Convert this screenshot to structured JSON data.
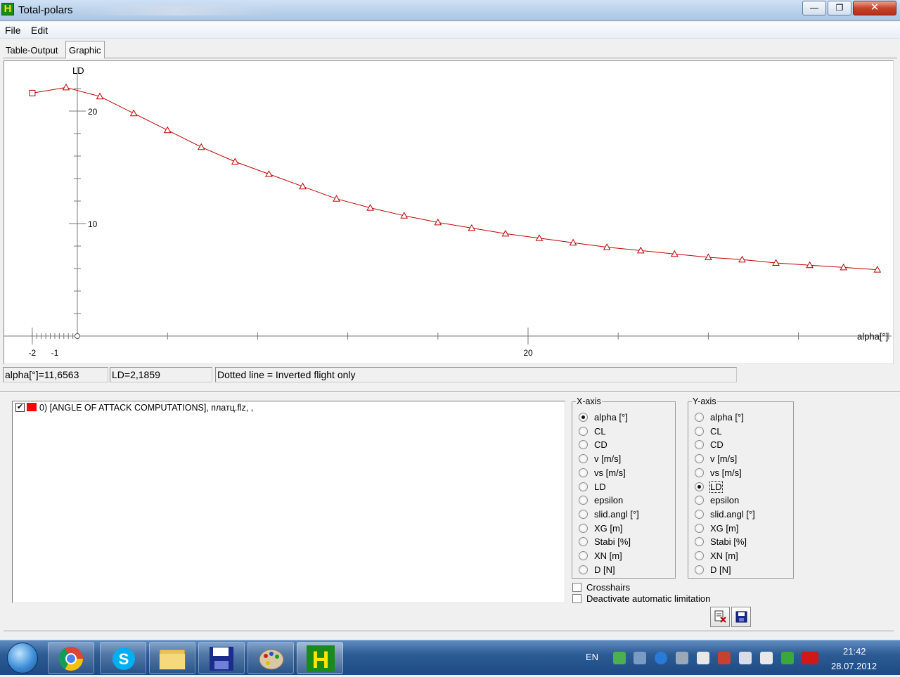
{
  "window": {
    "title": "Total-polars",
    "app_icon_letter": "H",
    "minimize_glyph": "—",
    "maximize_glyph": "❐",
    "close_glyph": "✕"
  },
  "menu": {
    "items": [
      "File",
      "Edit"
    ]
  },
  "tabs": [
    {
      "label": "Table-Output",
      "active": false
    },
    {
      "label": "Graphic",
      "active": true
    }
  ],
  "chart_data": {
    "type": "line",
    "xlabel": "alpha[°]",
    "ylabel": "LD",
    "xlim": [
      -2.0,
      36.0
    ],
    "ylim": [
      -1.0,
      22.5
    ],
    "x_tick_labels": [
      {
        "value": -2,
        "label": "-2"
      },
      {
        "value": -1,
        "label": "-1"
      },
      {
        "value": 20,
        "label": "20"
      }
    ],
    "y_tick_labels": [
      {
        "value": 10,
        "label": "10"
      },
      {
        "value": 20,
        "label": "20"
      }
    ],
    "series": [
      {
        "color": "#c00000",
        "x": [
          -2.0,
          -0.5,
          1.0,
          2.5,
          4.0,
          5.5,
          7.0,
          8.5,
          10.0,
          11.5,
          13.0,
          14.5,
          16.0,
          17.5,
          19.0,
          20.5,
          22.0,
          23.5,
          25.0,
          26.5,
          28.0,
          29.5,
          31.0,
          32.5,
          34.0,
          35.5
        ],
        "y": [
          21.6,
          22.1,
          21.3,
          19.8,
          18.3,
          16.8,
          15.5,
          14.4,
          13.3,
          12.2,
          11.4,
          10.7,
          10.1,
          9.6,
          9.1,
          8.7,
          8.3,
          7.9,
          7.6,
          7.3,
          7.0,
          6.8,
          6.5,
          6.3,
          6.1,
          5.9
        ]
      }
    ]
  },
  "status": {
    "alpha": "alpha[°]=11,6563",
    "ld": "LD=2,1859",
    "note": "Dotted line = Inverted flight only"
  },
  "series_list": {
    "items": [
      {
        "label": "0) [ANGLE OF ATTACK COMPUTATIONS], платц.flz, ,",
        "checked": true,
        "color": "#ff0000"
      }
    ]
  },
  "x_axis": {
    "title": "X-axis",
    "selected": "alpha [°]",
    "options": [
      "alpha [°]",
      "CL",
      "CD",
      "v [m/s]",
      "vs [m/s]",
      "LD",
      "epsilon",
      "slid.angl [°]",
      "XG [m]",
      "Stabi [%]",
      "XN [m]",
      "D [N]"
    ]
  },
  "y_axis": {
    "title": "Y-axis",
    "selected": "LD",
    "options": [
      "alpha [°]",
      "CL",
      "CD",
      "v [m/s]",
      "vs [m/s]",
      "LD",
      "epsilon",
      "slid.angl [°]",
      "XG [m]",
      "Stabi [%]",
      "XN [m]",
      "D [N]"
    ]
  },
  "options": {
    "crosshairs_label": "Crosshairs",
    "crosshairs_checked": false,
    "deactivate_label": "Deactivate automatic limitation",
    "deactivate_checked": false
  },
  "toolbar": {
    "copy_icon": "copy-icon",
    "save_icon": "save-icon"
  },
  "taskbar": {
    "language": "EN",
    "time": "21:42",
    "date": "28.07.2012"
  }
}
